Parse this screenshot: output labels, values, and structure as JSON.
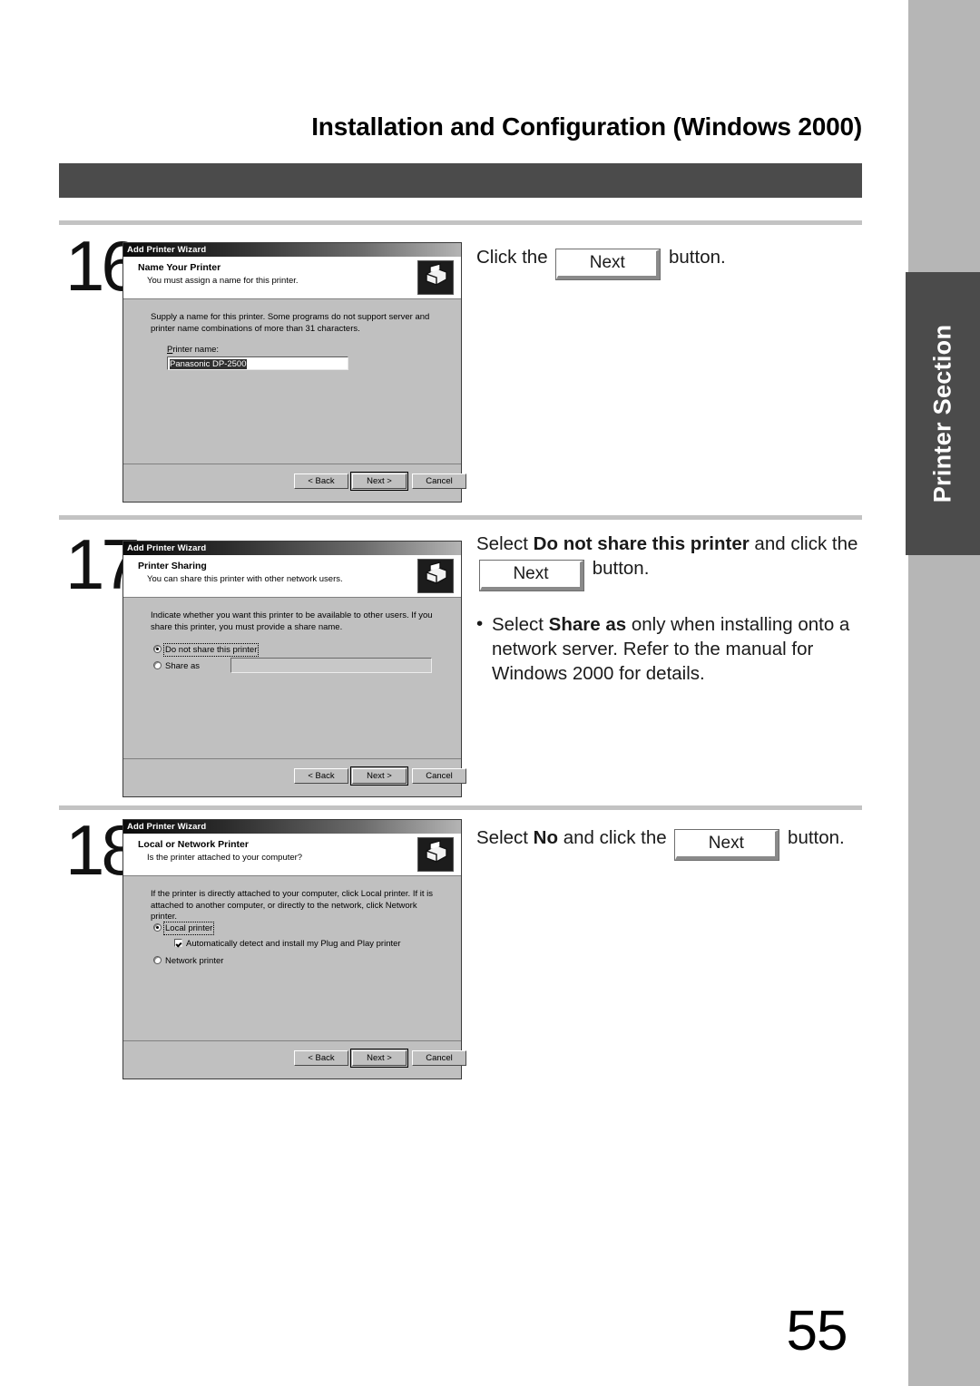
{
  "document": {
    "header_title": "Installation and Configuration (Windows 2000)",
    "section_tab_label": "Printer Section",
    "page_number": "55"
  },
  "steps": [
    {
      "number": "16",
      "instruction": {
        "prefix": "Click the ",
        "button_label": "Next",
        "suffix": " button."
      },
      "dialog": {
        "titlebar": "Add Printer Wizard",
        "banner_title": "Name Your Printer",
        "banner_sub": "You must assign a name for this printer.",
        "body_text": "Supply a name for this printer. Some programs do not support server and printer name combinations of more than 31 characters.",
        "field_label": "Printer name:",
        "field_value": "Panasonic DP-2500",
        "buttons": {
          "back": "< Back",
          "next": "Next >",
          "cancel": "Cancel"
        },
        "icon": "printer-icon"
      }
    },
    {
      "number": "17",
      "instruction": {
        "line1_prefix": "Select ",
        "line1_bold": "Do not share this printer",
        "line1_suffix": " and click the ",
        "button_label": "Next",
        "line2_suffix": " button.",
        "bullet_prefix": "Select ",
        "bullet_bold": "Share as",
        "bullet_suffix": " only when installing onto a network server.  Refer to the manual for Windows 2000 for details.",
        "bullet_char": "•"
      },
      "dialog": {
        "titlebar": "Add Printer Wizard",
        "banner_title": "Printer Sharing",
        "banner_sub": "You can share this printer with other network users.",
        "body_text": "Indicate whether you want this printer to be available to other users. If you share this printer, you must provide a share name.",
        "option_do_not_share": "Do not share this printer",
        "option_share_as": "Share as",
        "share_as_value": "",
        "buttons": {
          "back": "< Back",
          "next": "Next >",
          "cancel": "Cancel"
        },
        "icon": "printer-icon"
      }
    },
    {
      "number": "18",
      "instruction": {
        "prefix": "Select ",
        "bold": "No",
        "middle": " and click the ",
        "button_label": "Next",
        "suffix": " button."
      },
      "dialog": {
        "titlebar": "Add Printer Wizard",
        "banner_title": "Local or Network Printer",
        "banner_sub": "Is the printer attached to your computer?",
        "body_text": "If the printer is directly attached to your computer, click Local printer.  If it is attached to another computer, or directly to the network, click Network printer.",
        "option_local": "Local printer",
        "option_autodetect": "Automatically detect and install my Plug and Play printer",
        "option_network": "Network printer",
        "buttons": {
          "back": "< Back",
          "next": "Next >",
          "cancel": "Cancel"
        },
        "icon": "printer-icon"
      }
    }
  ],
  "colors": {
    "header_bar": "#4b4b4b",
    "section_tab": "#4b4b4b",
    "side_strip": "#b6b6b6",
    "rule": "#c3c3c3",
    "dialog_face": "#c0c0c0"
  }
}
